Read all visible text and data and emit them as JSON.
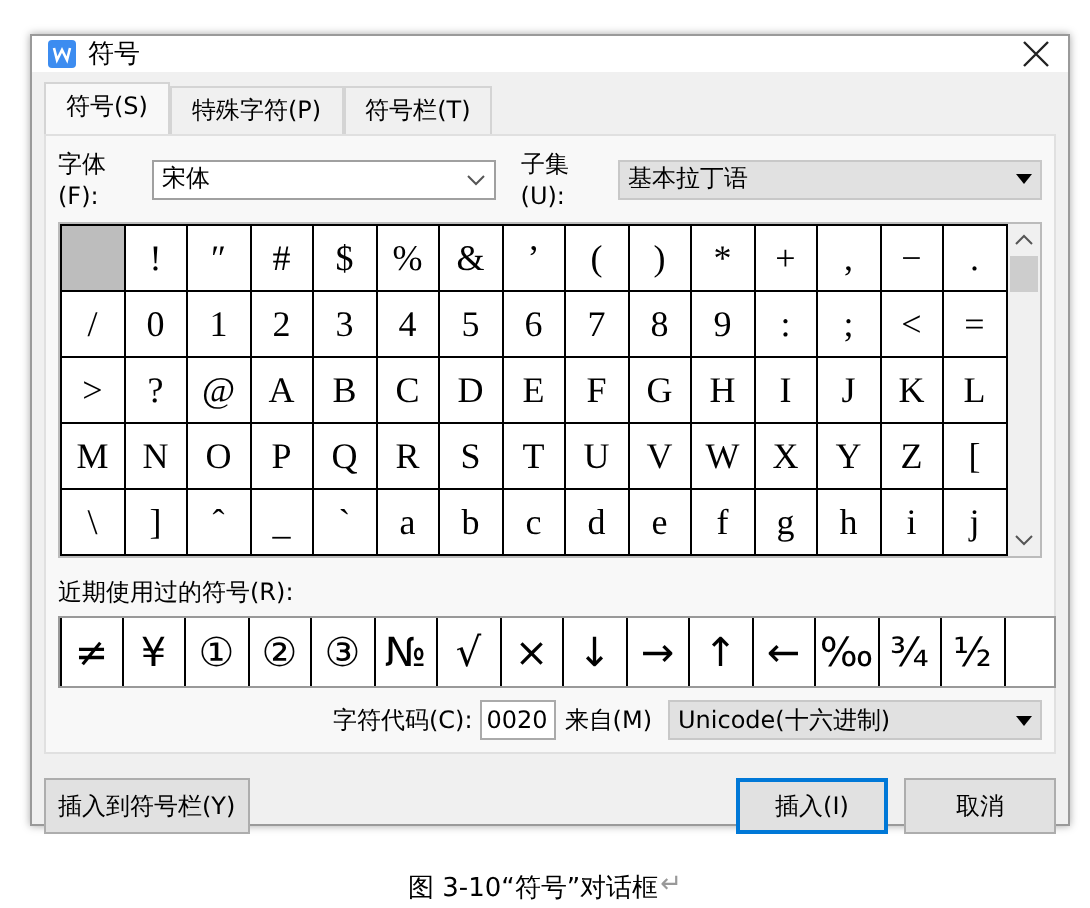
{
  "window": {
    "title": "符号"
  },
  "tabs": [
    {
      "label": "符号(S)",
      "selected": true
    },
    {
      "label": "特殊字符(P)",
      "selected": false
    },
    {
      "label": "符号栏(T)",
      "selected": false
    }
  ],
  "font": {
    "label": "字体(F):",
    "value": "宋体"
  },
  "subset": {
    "label": "子集(U):",
    "value": "基本拉丁语"
  },
  "symbols": [
    {
      "selected": true
    },
    {
      "char": "!",
      "selected": false
    },
    {
      "char": "″",
      "selected": false
    },
    {
      "char": "#",
      "selected": false
    },
    {
      "char": "$",
      "selected": false
    },
    {
      "char": "%",
      "selected": false
    },
    {
      "char": "&",
      "selected": false
    },
    {
      "char": "’",
      "selected": false
    },
    {
      "char": "(",
      "selected": false
    },
    {
      "char": ")",
      "selected": false
    },
    {
      "char": "*",
      "selected": false
    },
    {
      "char": "+",
      "selected": false
    },
    {
      "char": ",",
      "selected": false
    },
    {
      "char": "−",
      "selected": false
    },
    {
      "char": ".",
      "selected": false
    },
    {
      "char": "/",
      "selected": false
    },
    {
      "char": "0",
      "selected": false
    },
    {
      "char": "1",
      "selected": false
    },
    {
      "char": "2",
      "selected": false
    },
    {
      "char": "3",
      "selected": false
    },
    {
      "char": "4",
      "selected": false
    },
    {
      "char": "5",
      "selected": false
    },
    {
      "char": "6",
      "selected": false
    },
    {
      "char": "7",
      "selected": false
    },
    {
      "char": "8",
      "selected": false
    },
    {
      "char": "9",
      "selected": false
    },
    {
      "char": ":",
      "selected": false
    },
    {
      "char": ";",
      "selected": false
    },
    {
      "char": "<",
      "selected": false
    },
    {
      "char": "=",
      "selected": false
    },
    {
      "char": ">",
      "selected": false
    },
    {
      "char": "?",
      "selected": false
    },
    {
      "char": "@",
      "selected": false
    },
    {
      "char": "A",
      "selected": false
    },
    {
      "char": "B",
      "selected": false
    },
    {
      "char": "C",
      "selected": false
    },
    {
      "char": "D",
      "selected": false
    },
    {
      "char": "E",
      "selected": false
    },
    {
      "char": "F",
      "selected": false
    },
    {
      "char": "G",
      "selected": false
    },
    {
      "char": "H",
      "selected": false
    },
    {
      "char": "I",
      "selected": false
    },
    {
      "char": "J",
      "selected": false
    },
    {
      "char": "K",
      "selected": false
    },
    {
      "char": "L",
      "selected": false
    },
    {
      "char": "M",
      "selected": false
    },
    {
      "char": "N",
      "selected": false
    },
    {
      "char": "O",
      "selected": false
    },
    {
      "char": "P",
      "selected": false
    },
    {
      "char": "Q",
      "selected": false
    },
    {
      "char": "R",
      "selected": false
    },
    {
      "char": "S",
      "selected": false
    },
    {
      "char": "T",
      "selected": false
    },
    {
      "char": "U",
      "selected": false
    },
    {
      "char": "V",
      "selected": false
    },
    {
      "char": "W",
      "selected": false
    },
    {
      "char": "X",
      "selected": false
    },
    {
      "char": "Y",
      "selected": false
    },
    {
      "char": "Z",
      "selected": false
    },
    {
      "char": "[",
      "selected": false
    },
    {
      "char": "\\",
      "selected": false
    },
    {
      "char": "]",
      "selected": false
    },
    {
      "char": "ˆ",
      "selected": false
    },
    {
      "char": "_",
      "selected": false
    },
    {
      "char": "`",
      "selected": false
    },
    {
      "char": "a",
      "selected": false
    },
    {
      "char": "b",
      "selected": false
    },
    {
      "char": "c",
      "selected": false
    },
    {
      "char": "d",
      "selected": false
    },
    {
      "char": "e",
      "selected": false
    },
    {
      "char": "f",
      "selected": false
    },
    {
      "char": "g",
      "selected": false
    },
    {
      "char": "h",
      "selected": false
    },
    {
      "char": "i",
      "selected": false
    },
    {
      "char": "j",
      "selected": false
    }
  ],
  "recent": {
    "label": "近期使用过的符号(R):",
    "symbols": [
      "≠",
      "¥",
      "①",
      "②",
      "③",
      "№",
      "√",
      "×",
      "↓",
      "→",
      "↑",
      "←",
      "‰",
      "¾",
      "½"
    ]
  },
  "char_code": {
    "label": "字符代码(C):",
    "value": "0020"
  },
  "from": {
    "label": "来自(M)",
    "value": "Unicode(十六进制)"
  },
  "buttons": {
    "add_to_bar": "插入到符号栏(Y)",
    "insert": "插入(I)",
    "cancel": "取消"
  },
  "caption": {
    "text": "图 3-10“符号”对话框",
    "mark": "↵"
  }
}
